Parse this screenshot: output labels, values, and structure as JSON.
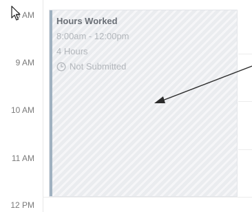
{
  "time_axis": {
    "labels": [
      "8 AM",
      "9 AM",
      "10 AM",
      "11 AM",
      "12 PM"
    ]
  },
  "event": {
    "title": "Hours Worked",
    "time_range": "8:00am - 12:00pm",
    "duration": "4 Hours",
    "status": "Not Submitted",
    "status_icon": "clock-icon",
    "accent_color": "#9fb1c0"
  },
  "annotation": {
    "type": "arrow-pointer",
    "color": "#2b2b2b"
  },
  "cursor": {
    "icon": "mouse-pointer-icon"
  }
}
